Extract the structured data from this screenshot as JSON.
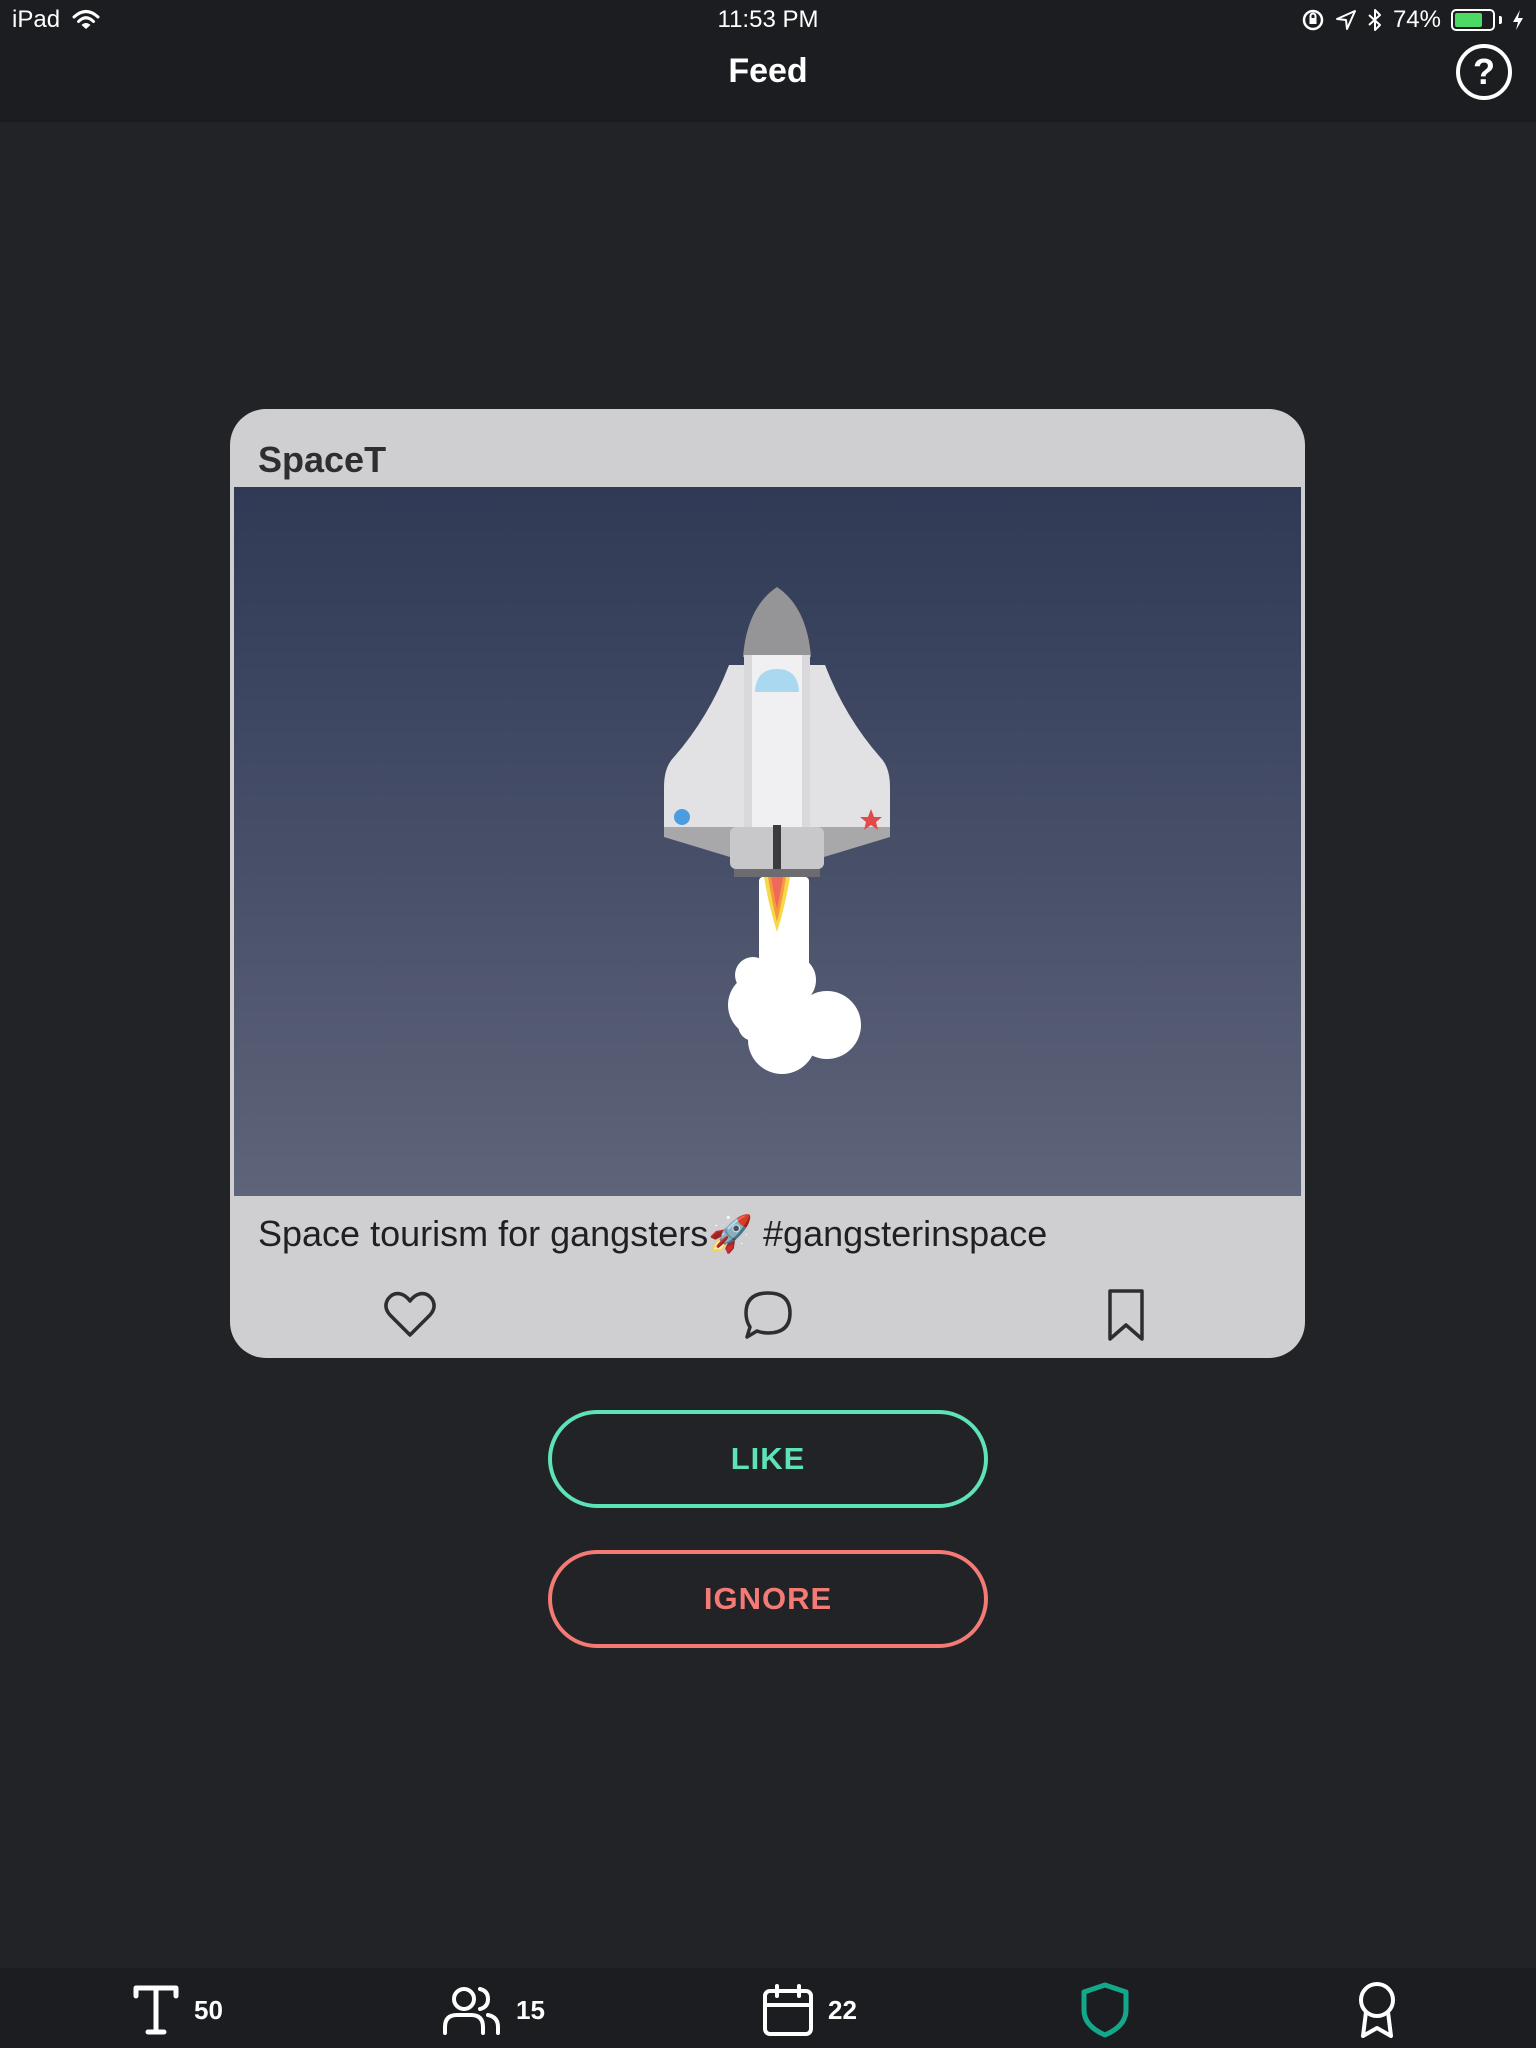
{
  "status_bar": {
    "device": "iPad",
    "time": "11:53 PM",
    "battery_percent": "74%",
    "battery_level": 0.74,
    "icons": [
      "wifi-icon",
      "orientation-lock-icon",
      "location-icon",
      "bluetooth-icon",
      "battery-icon",
      "charging-icon"
    ]
  },
  "nav": {
    "title": "Feed",
    "help_icon": "question-circle-icon",
    "help_label": "?"
  },
  "card": {
    "author": "SpaceT",
    "image_subject": "space-shuttle-illustration",
    "caption": "Space tourism for gangsters🚀 #gangsterinspace",
    "actions": [
      "heart-icon",
      "comment-icon",
      "bookmark-icon"
    ]
  },
  "buttons": {
    "like_label": "LIKE",
    "ignore_label": "IGNORE",
    "like_color": "#5ee3b7",
    "ignore_color": "#f47a76"
  },
  "tab_bar": {
    "tabs": [
      {
        "icon": "text-icon",
        "count": "50"
      },
      {
        "icon": "users-icon",
        "count": "15"
      },
      {
        "icon": "calendar-icon",
        "count": "22"
      },
      {
        "icon": "shield-icon",
        "count": "",
        "active": true
      },
      {
        "icon": "award-icon",
        "count": ""
      }
    ],
    "active_color": "#14a88a"
  }
}
